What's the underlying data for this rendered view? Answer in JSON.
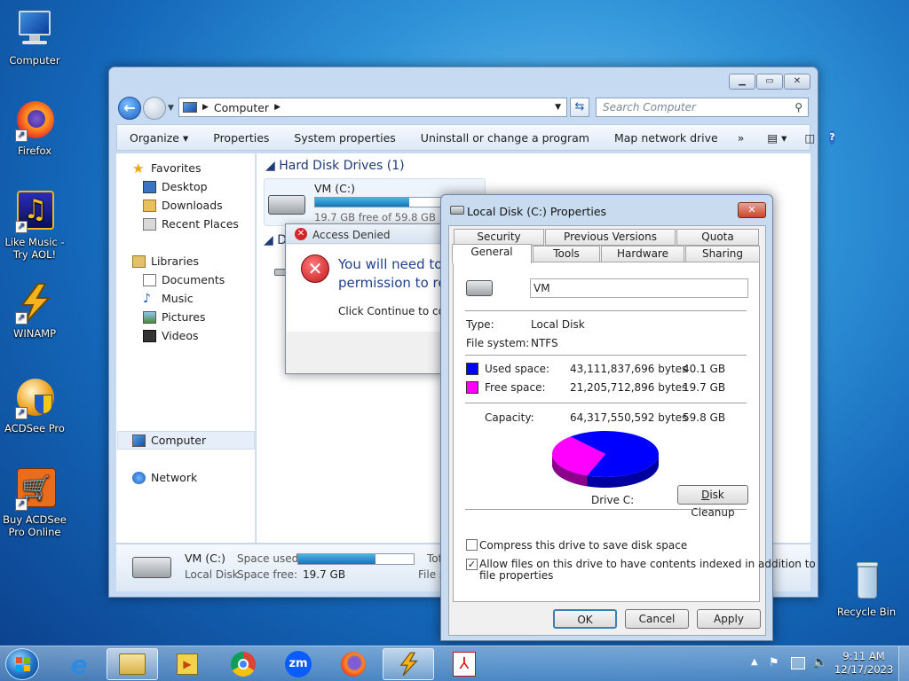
{
  "desktop": {
    "icons": [
      {
        "label": "Computer"
      },
      {
        "label": "Firefox"
      },
      {
        "label": "Like Music - Try AOL!"
      },
      {
        "label": "WINAMP"
      },
      {
        "label": "ACDSee Pro"
      },
      {
        "label": "Buy ACDSee Pro Online"
      },
      {
        "label": "Recycle Bin"
      }
    ]
  },
  "explorer": {
    "address": "Computer",
    "search_placeholder": "Search Computer",
    "toolbar": [
      "Organize",
      "Properties",
      "System properties",
      "Uninstall or change a program",
      "Map network drive",
      "»"
    ],
    "nav": {
      "favorites": "Favorites",
      "favorites_items": [
        "Desktop",
        "Downloads",
        "Recent Places"
      ],
      "libraries": "Libraries",
      "libraries_items": [
        "Documents",
        "Music",
        "Pictures",
        "Videos"
      ],
      "computer": "Computer",
      "network": "Network"
    },
    "section_title": "Hard Disk Drives (1)",
    "section2_partial": "D",
    "drive": {
      "name": "VM (C:)",
      "free_text": "19.7 GB free of 59.8 GB"
    },
    "details": {
      "name": "VM (C:)",
      "type": "Local Disk",
      "space_used_label": "Space used:",
      "space_free_label": "Space free:",
      "space_free_value": "19.7 GB",
      "total_partial": "Tot",
      "file_partial": "File s"
    }
  },
  "access_denied": {
    "title": "Access Denied",
    "message": "You will need to permission to re",
    "message_line1": "You will need to",
    "message_line2": "permission to re",
    "continue_text": "Click Continue to con"
  },
  "properties": {
    "title": "Local Disk (C:) Properties",
    "tabs_top": [
      "Security",
      "Previous Versions",
      "Quota"
    ],
    "tabs_bottom": [
      "General",
      "Tools",
      "Hardware",
      "Sharing"
    ],
    "volume_name": "VM",
    "type_label": "Type:",
    "type_value": "Local Disk",
    "fs_label": "File system:",
    "fs_value": "NTFS",
    "used_label": "Used space:",
    "used_bytes": "43,111,837,696 bytes",
    "used_gb": "40.1 GB",
    "free_label": "Free space:",
    "free_bytes": "21,205,712,896 bytes",
    "free_gb": "19.7 GB",
    "capacity_label": "Capacity:",
    "capacity_bytes": "64,317,550,592 bytes",
    "capacity_gb": "59.8 GB",
    "drive_label": "Drive C:",
    "disk_cleanup": "Disk Cleanup",
    "compress_label": "Compress this drive to save disk space",
    "index_label": "Allow files on this drive to have contents indexed in addition to file properties",
    "index_line1": "Allow files on this drive to have contents indexed in addition to",
    "index_line2": "file properties",
    "ok": "OK",
    "cancel": "Cancel",
    "apply": "Apply",
    "used_fraction": 0.67,
    "colors": {
      "used": "#0000ff",
      "free": "#ff00ff"
    }
  },
  "taskbar": {
    "time": "9:11 AM",
    "date": "12/17/2023"
  }
}
